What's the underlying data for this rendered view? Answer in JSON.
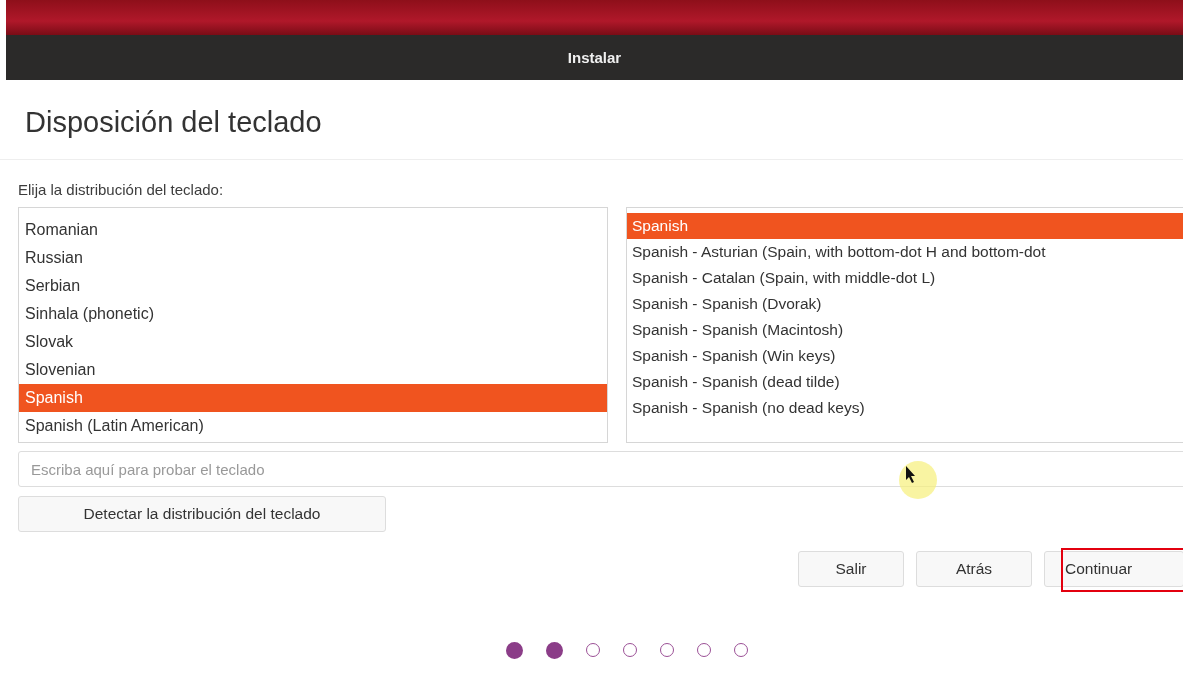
{
  "window": {
    "title": "Instalar"
  },
  "heading": "Disposición del teclado",
  "layout_label": "Elija la distribución del teclado:",
  "layouts": [
    {
      "label": "Romanian",
      "selected": false
    },
    {
      "label": "Russian",
      "selected": false
    },
    {
      "label": "Serbian",
      "selected": false
    },
    {
      "label": "Sinhala (phonetic)",
      "selected": false
    },
    {
      "label": "Slovak",
      "selected": false
    },
    {
      "label": "Slovenian",
      "selected": false
    },
    {
      "label": "Spanish",
      "selected": true
    },
    {
      "label": "Spanish (Latin American)",
      "selected": false
    }
  ],
  "variants": [
    {
      "label": "Spanish",
      "selected": true
    },
    {
      "label": "Spanish - Asturian (Spain, with bottom-dot H and bottom-dot",
      "selected": false
    },
    {
      "label": "Spanish - Catalan (Spain, with middle-dot L)",
      "selected": false
    },
    {
      "label": "Spanish - Spanish (Dvorak)",
      "selected": false
    },
    {
      "label": "Spanish - Spanish (Macintosh)",
      "selected": false
    },
    {
      "label": "Spanish - Spanish (Win keys)",
      "selected": false
    },
    {
      "label": "Spanish - Spanish (dead tilde)",
      "selected": false
    },
    {
      "label": "Spanish - Spanish (no dead keys)",
      "selected": false
    }
  ],
  "test_field": {
    "placeholder": "Escriba aquí para probar el teclado"
  },
  "detect_button": "Detectar la distribución del teclado",
  "buttons": [
    {
      "label": "Salir",
      "highlighted": false
    },
    {
      "label": "Atrás",
      "highlighted": false
    },
    {
      "label": "Continuar",
      "highlighted": true
    }
  ],
  "steps": [
    {
      "filled": true
    },
    {
      "filled": true
    },
    {
      "filled": false
    },
    {
      "filled": false
    },
    {
      "filled": false
    },
    {
      "filled": false
    },
    {
      "filled": false
    }
  ]
}
